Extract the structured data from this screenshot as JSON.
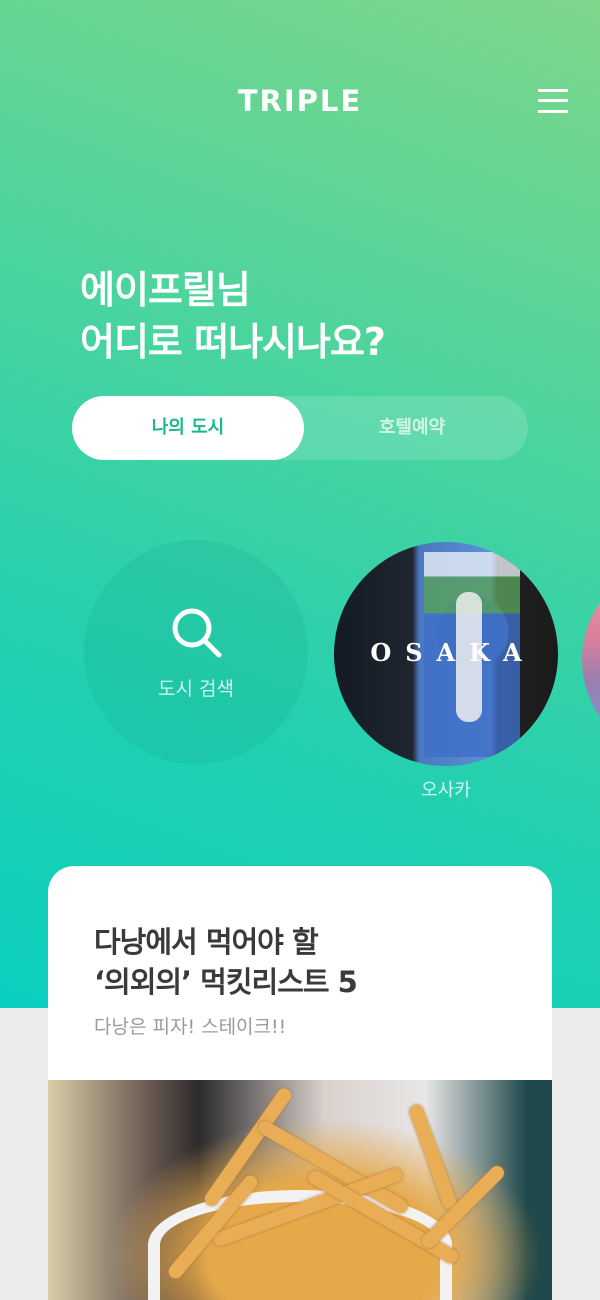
{
  "header": {
    "logo": "TRIPLE",
    "menu_icon": "hamburger-menu-icon"
  },
  "greeting": {
    "line1": "에이프릴님",
    "line2": "어디로 떠나시나요?"
  },
  "tabs": [
    {
      "label": "나의 도시",
      "active": true
    },
    {
      "label": "호텔예약",
      "active": false
    }
  ],
  "cities": {
    "search": {
      "label": "도시 검색",
      "icon": "search-icon"
    },
    "items": [
      {
        "name_overlay": "OSAKA",
        "label": "오사카"
      }
    ]
  },
  "article": {
    "title_line1": "다낭에서 먹어야 할",
    "title_line2": "‘의외의’ 먹킷리스트 5",
    "subtitle": "다낭은 피자! 스테이크!!"
  },
  "colors": {
    "accent": "#1bb88d",
    "gradient_top": "#7ed68b",
    "gradient_bottom": "#0acfbf",
    "background": "#ebebeb"
  }
}
